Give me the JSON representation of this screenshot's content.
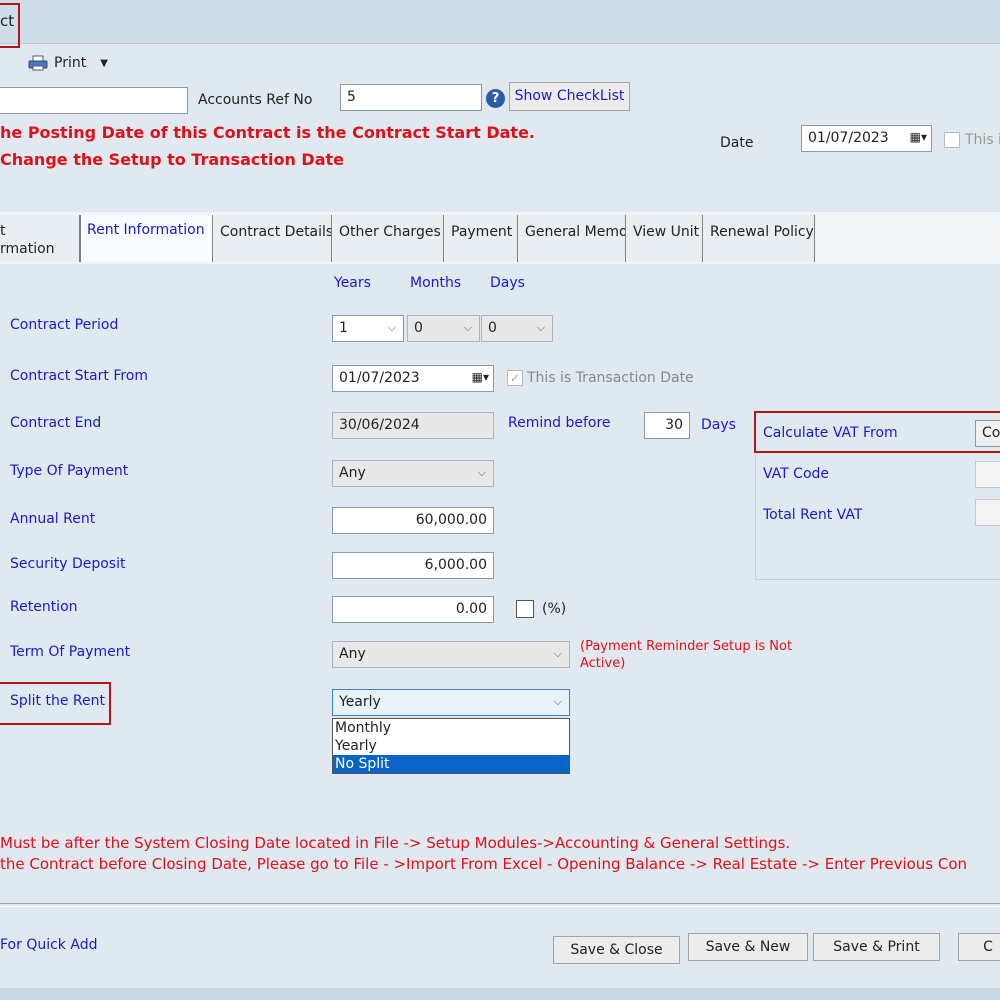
{
  "window": {
    "title_fragment": "ct"
  },
  "toolbar": {
    "print_label": "Print"
  },
  "header": {
    "accounts_ref_label": "Accounts Ref No",
    "accounts_ref_value": "5",
    "show_checklist_label": "Show CheckList",
    "warning_line1": "he Posting Date of this Contract is the Contract Start Date.",
    "warning_line2": "Change the Setup to Transaction Date",
    "date_label": "Date",
    "date_value": "01/07/2023",
    "this_is_label": "This is"
  },
  "tabs": [
    {
      "label": "t\nrmation"
    },
    {
      "label": "Rent Information"
    },
    {
      "label": "Contract Details"
    },
    {
      "label": "Other Charges"
    },
    {
      "label": "Payment"
    },
    {
      "label": "General Memo"
    },
    {
      "label": "View Unit"
    },
    {
      "label": "Renewal Policy"
    }
  ],
  "form": {
    "period_headers": {
      "years": "Years",
      "months": "Months",
      "days": "Days"
    },
    "contract_period_label": "Contract Period",
    "period_years": "1",
    "period_months": "0",
    "period_days": "0",
    "start_label": "Contract Start From",
    "start_value": "01/07/2023",
    "transaction_date_label": "This is Transaction Date",
    "end_label": "Contract End",
    "end_value": "30/06/2024",
    "remind_label": "Remind before",
    "remind_value": "30",
    "remind_unit": "Days",
    "type_payment_label": "Type Of Payment",
    "type_payment_value": "Any",
    "annual_rent_label": "Annual Rent",
    "annual_rent_value": "60,000.00",
    "security_label": "Security Deposit",
    "security_value": "6,000.00",
    "retention_label": "Retention",
    "retention_value": "0.00",
    "retention_pct_label": "(%)",
    "term_label": "Term Of Payment",
    "term_value": "Any",
    "term_note": "(Payment Reminder Setup is Not\nActive)",
    "split_label": "Split the Rent",
    "split_value": "Yearly",
    "split_options": [
      "Monthly",
      "Yearly",
      "No Split"
    ],
    "split_highlighted": "No Split"
  },
  "vat": {
    "calc_label": "Calculate VAT From",
    "calc_value": "Co",
    "code_label": "VAT Code",
    "total_label": "Total Rent VAT"
  },
  "footer": {
    "note1": "Must be after the System Closing Date located in File -> Setup Modules->Accounting & General Settings.",
    "note2": "the Contract before Closing Date, Please go to File - >Import From Excel - Opening Balance -> Real Estate -> Enter Previous Con",
    "quick_add": "For Quick Add",
    "save_close": "Save & Close",
    "save_new": "Save & New",
    "save_print": "Save & Print",
    "cancel_fragment": "C"
  },
  "colors": {
    "window_bg": "#dfe9ef",
    "label_blue": "#1a1acc",
    "warning_red": "#e0101a",
    "highlight_box": "#b01818",
    "selected_option": "#0a64c8"
  }
}
